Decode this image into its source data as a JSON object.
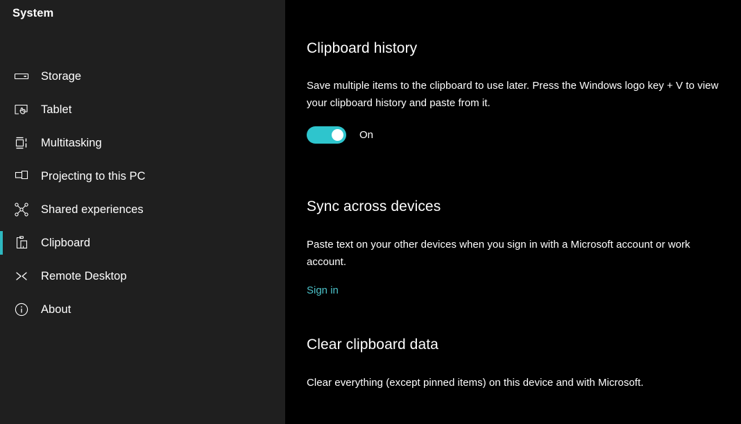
{
  "theme": {
    "sidebar_bg": "#1f1f1f",
    "content_bg": "#000000",
    "accent": "#2eb8c0",
    "toggle_on": "#2ec5cd",
    "link_color": "#4cc2c9",
    "text_color": "#ffffff"
  },
  "sidebar": {
    "title": "System",
    "items": [
      {
        "label": "Storage",
        "icon": "storage-icon",
        "selected": false
      },
      {
        "label": "Tablet",
        "icon": "tablet-icon",
        "selected": false
      },
      {
        "label": "Multitasking",
        "icon": "multitasking-icon",
        "selected": false
      },
      {
        "label": "Projecting to this PC",
        "icon": "projecting-icon",
        "selected": false
      },
      {
        "label": "Shared experiences",
        "icon": "shared-experiences-icon",
        "selected": false
      },
      {
        "label": "Clipboard",
        "icon": "clipboard-icon",
        "selected": true
      },
      {
        "label": "Remote Desktop",
        "icon": "remote-desktop-icon",
        "selected": false
      },
      {
        "label": "About",
        "icon": "info-icon",
        "selected": false
      }
    ]
  },
  "main": {
    "clipboard_history": {
      "title": "Clipboard history",
      "description": "Save multiple items to the clipboard to use later. Press the Windows logo key + V to view your clipboard history and paste from it.",
      "toggle_state": "On"
    },
    "sync_across_devices": {
      "title": "Sync across devices",
      "description": "Paste text on your other devices when you sign in with a Microsoft account or work account.",
      "sign_in_label": "Sign in"
    },
    "clear_clipboard_data": {
      "title": "Clear clipboard data",
      "description": "Clear everything (except pinned items) on this device and with Microsoft."
    }
  }
}
